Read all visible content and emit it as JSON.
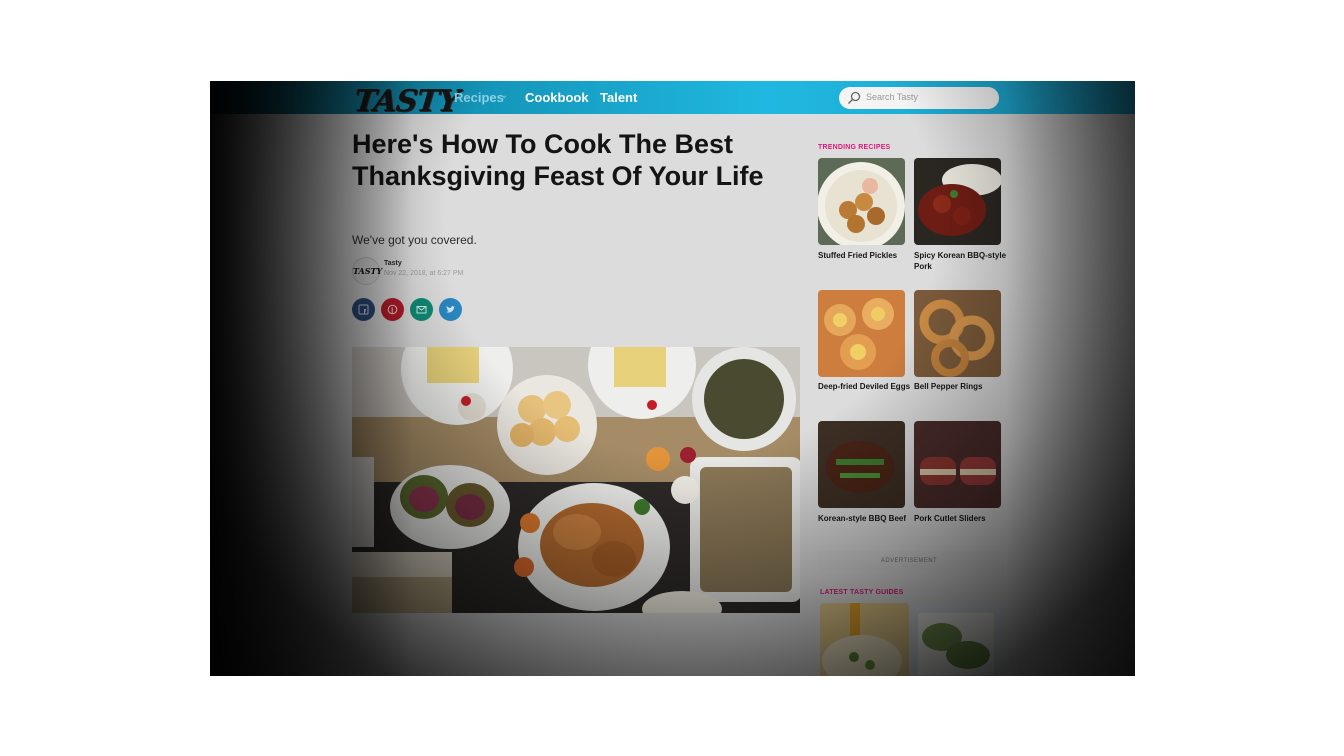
{
  "nav": {
    "logo": "TASTY",
    "links": [
      "Recipes",
      "Cookbook",
      "Talent"
    ],
    "search_placeholder": "Search Tasty"
  },
  "article": {
    "title": "Here's How To Cook The Best Thanksgiving Feast Of Your Life",
    "subtitle": "We've got you covered.",
    "avatar_text": "TASTY",
    "author": "Tasty",
    "date": "Nov 22, 2018, at 6:27 PM",
    "share_icons": [
      "facebook-icon",
      "pinterest-icon",
      "email-icon",
      "twitter-icon"
    ]
  },
  "sidebar": {
    "trending_heading": "TRENDING RECIPES",
    "trending": [
      {
        "label": "Stuffed Fried Pickles"
      },
      {
        "label": "Spicy Korean BBQ-style Pork"
      },
      {
        "label": "Deep-fried Deviled Eggs"
      },
      {
        "label": "Bell Pepper Rings"
      },
      {
        "label": "Korean-style BBQ Beef"
      },
      {
        "label": "Pork Cutlet Sliders"
      }
    ],
    "ad_label": "ADVERTISEMENT",
    "guides_heading": "LATEST TASTY GUIDES"
  },
  "colors": {
    "nav": "#20b8e0",
    "accent_pink": "#e0197d",
    "facebook": "#2d4a7c",
    "pinterest": "#b51d2a",
    "email": "#0f8b75",
    "twitter": "#2a87c0"
  }
}
